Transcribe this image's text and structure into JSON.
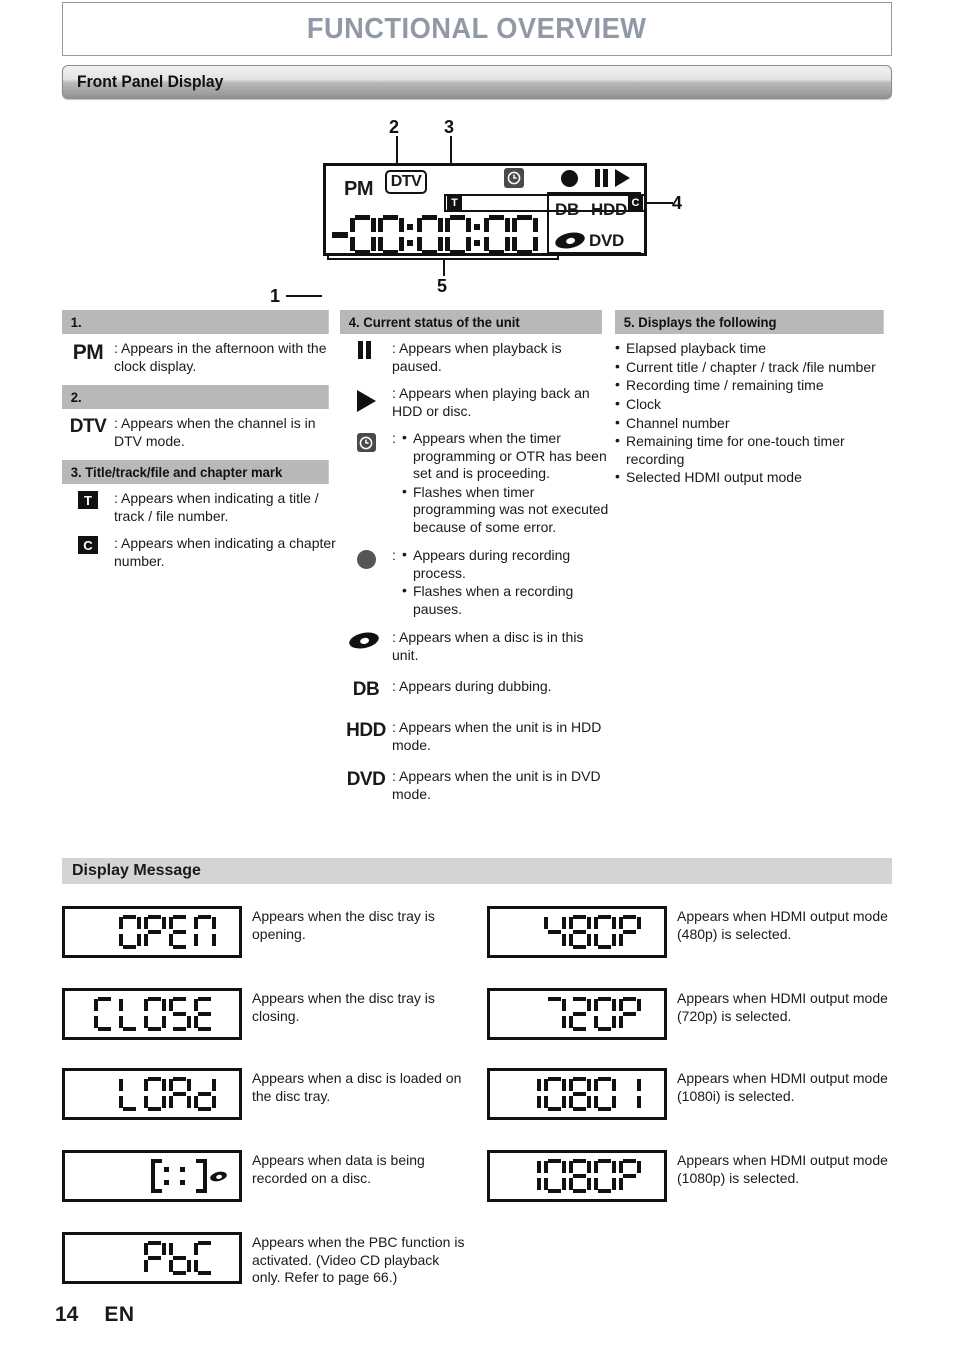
{
  "page": {
    "title": "FUNCTIONAL OVERVIEW",
    "section_title": "Front Panel Display",
    "display_message_title": "Display Message",
    "page_number": "14",
    "language_code": "EN"
  },
  "diagram": {
    "callouts": [
      "1",
      "2",
      "3",
      "4",
      "5"
    ],
    "lcd": {
      "pm": "PM",
      "dtv": "DTV",
      "title_mark": "T",
      "chapter_mark": "C",
      "db": "DB",
      "hdd": "HDD",
      "dvd": "DVD",
      "digits": "-88:88:88"
    }
  },
  "columns": {
    "col1": {
      "sections": [
        {
          "heading": "1.",
          "entries": [
            {
              "glyph": "PM",
              "glyph_type": "text",
              "desc": ": Appears in the afternoon with the clock display."
            }
          ]
        },
        {
          "heading": "2.",
          "entries": [
            {
              "glyph": "DTV",
              "glyph_type": "text",
              "desc": ": Appears when the channel is in DTV mode."
            }
          ]
        },
        {
          "heading": "3. Title/track/file and chapter mark",
          "entries": [
            {
              "glyph": "T",
              "glyph_type": "square",
              "desc": ": Appears when indicating a title / track / file number."
            },
            {
              "glyph": "C",
              "glyph_type": "square",
              "desc": ": Appears when indicating a chapter number."
            }
          ]
        }
      ]
    },
    "col2": {
      "heading": "4. Current status of the unit",
      "entries": [
        {
          "glyph": "pause-icon",
          "glyph_type": "icon",
          "desc": ": Appears when playback is paused.",
          "bullets": []
        },
        {
          "glyph": "play-icon",
          "glyph_type": "icon",
          "desc": ": Appears when playing back an HDD or disc.",
          "bullets": []
        },
        {
          "glyph": "timer-clock-icon",
          "glyph_type": "icon",
          "desc": "",
          "lead": ":",
          "bullets": [
            "Appears when the timer programming or OTR has been set and is proceeding.",
            "Flashes when timer programming was not executed because of some error."
          ]
        },
        {
          "glyph": "record-dot-icon",
          "glyph_type": "icon",
          "desc": "",
          "lead": ":",
          "bullets": [
            "Appears during recording process.",
            "Flashes when a recording pauses."
          ]
        },
        {
          "glyph": "disc-icon",
          "glyph_type": "icon",
          "desc": ": Appears when a disc is in this unit.",
          "bullets": []
        },
        {
          "glyph": "DB",
          "glyph_type": "text",
          "desc": ": Appears during dubbing.",
          "bullets": []
        },
        {
          "glyph": "HDD",
          "glyph_type": "text",
          "desc": ": Appears when the unit is in HDD mode.",
          "bullets": []
        },
        {
          "glyph": "DVD",
          "glyph_type": "text",
          "desc": ": Appears when the unit is in DVD mode.",
          "bullets": []
        }
      ]
    },
    "col3": {
      "heading": "5. Displays the following",
      "items": [
        "Elapsed playback time",
        "Current title / chapter / track /file number",
        "Recording time / remaining time",
        "Clock",
        "Channel number",
        "Remaining time for one-touch timer recording",
        "Selected HDMI output mode"
      ]
    }
  },
  "display_messages": {
    "left": [
      {
        "lcd": "OPEN",
        "caption": "Appears when the disc tray is opening."
      },
      {
        "lcd": "CLOSE",
        "caption": "Appears when the disc tray is closing."
      },
      {
        "lcd": "Load",
        "caption": "Appears when a disc is loaded on the disc tray."
      },
      {
        "lcd": "[ :: ]",
        "caption": "Appears when data is being recorded on a disc."
      },
      {
        "lcd": "Pbc",
        "caption": "Appears when the PBC function is activated. (Video CD playback only. Refer to page 66.)"
      }
    ],
    "right": [
      {
        "lcd": "480 P",
        "caption": "Appears when HDMI output mode (480p) is selected."
      },
      {
        "lcd": "720 P",
        "caption": "Appears when HDMI output mode (720p) is selected."
      },
      {
        "lcd": "1080 i",
        "caption": "Appears when HDMI output mode (1080i) is selected."
      },
      {
        "lcd": "1080 P",
        "caption": "Appears when HDMI output mode (1080p) is selected."
      }
    ]
  },
  "colors": {
    "title_gray": "#9099a5",
    "header_band": "#b8b8b8",
    "dm_band": "#d4d4d4",
    "ink": "#111111"
  }
}
